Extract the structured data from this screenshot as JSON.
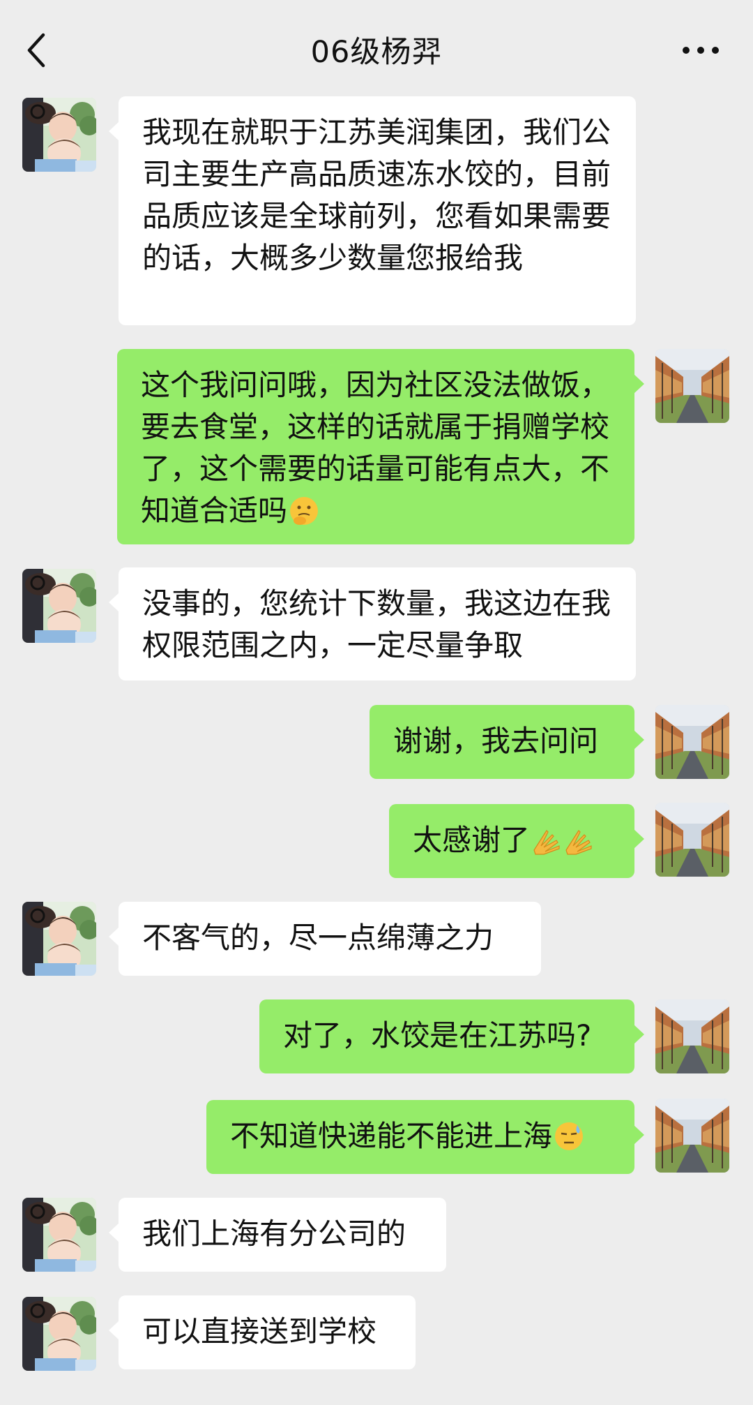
{
  "header": {
    "title": "06级杨羿"
  },
  "messages": [
    {
      "side": "left",
      "text": "我现在就职于江苏美润集团，我们公司主要生产高品质速冻水饺的，目前品质应该是全球前列，您看如果需要的话，大概多少数量您报给我"
    },
    {
      "side": "right",
      "text": "这个我问问哦，因为社区没法做饭，要去食堂，这样的话就属于捐赠学校了，这个需要的话量可能有点大，不知道合适吗",
      "emoji": [
        "thinking-face-icon"
      ]
    },
    {
      "side": "left",
      "text": "没事的，您统计下数量，我这边在我权限范围之内，一定尽量争取"
    },
    {
      "side": "right",
      "text": "谢谢，我去问问"
    },
    {
      "side": "right",
      "text": "太感谢了",
      "emoji": [
        "folded-hands-icon",
        "folded-hands-icon"
      ]
    },
    {
      "side": "left",
      "text": "不客气的，尽一点绵薄之力"
    },
    {
      "side": "right",
      "text": "对了，水饺是在江苏吗?"
    },
    {
      "side": "right",
      "text": "不知道快递能不能进上海",
      "emoji": [
        "sweat-face-icon"
      ]
    },
    {
      "side": "left",
      "text": "我们上海有分公司的"
    },
    {
      "side": "left",
      "text": "可以直接送到学校"
    }
  ],
  "colors": {
    "background": "#ededed",
    "incoming_bubble": "#ffffff",
    "outgoing_bubble": "#95ec69"
  }
}
